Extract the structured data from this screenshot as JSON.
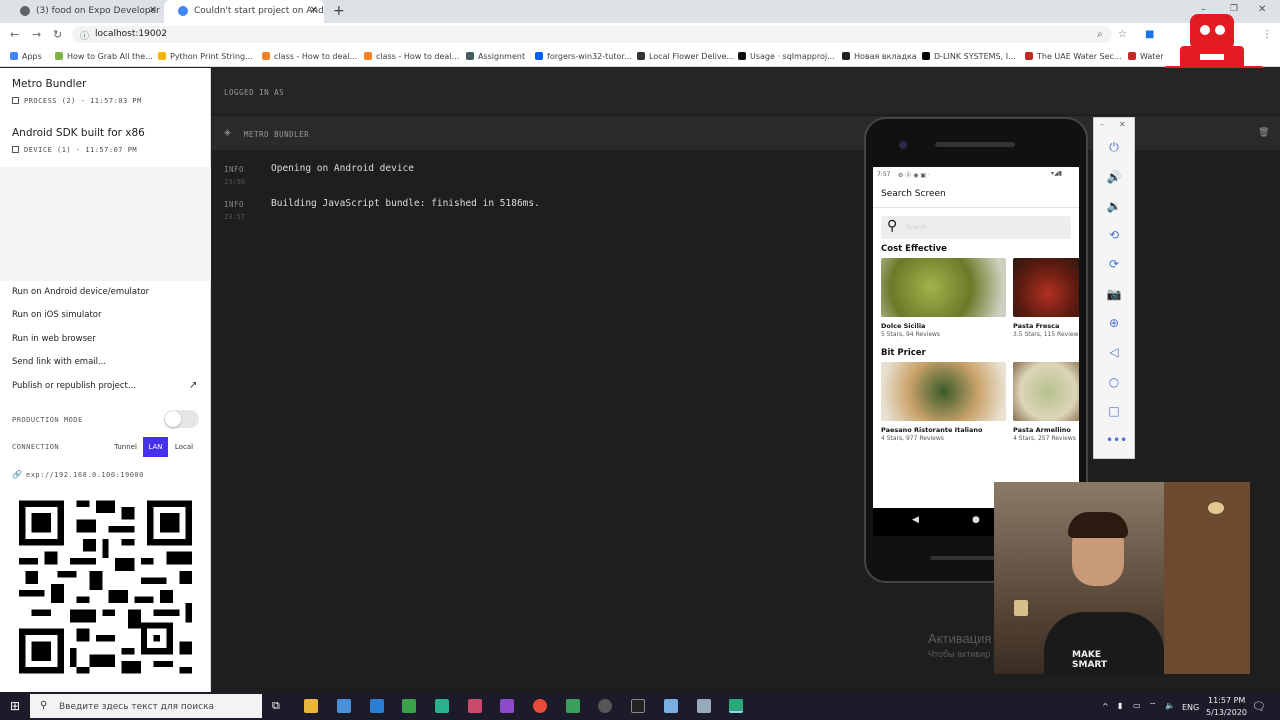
{
  "browser": {
    "tabs": [
      {
        "title": "(3) food on Expo Developer Tools"
      },
      {
        "title": "Couldn't start project on Android"
      }
    ],
    "new_tab": "+",
    "url": "localhost:19002",
    "bookmarks": [
      "Apps",
      "How to Grab All the...",
      "Python Print String...",
      "class - How to deal...",
      "class - How to deal...",
      "Assignment",
      "forgers-win32-tutor...",
      "Local Flower Delive...",
      "Usage · sqlmapproj...",
      "Новая вкладка",
      "D-LINK SYSTEMS, I...",
      "The UAE Water Sec...",
      "Water"
    ]
  },
  "sidebar": {
    "bundler_title": "Metro Bundler",
    "bundler_process": "PROCESS (2) - 11:57:03 PM",
    "device_title": "Android SDK built for x86",
    "device_info": "DEVICE (1) - 11:57:07 PM",
    "actions": [
      "Run on Android device/emulator",
      "Run on iOS simulator",
      "Run in web browser",
      "Send link with email...",
      "Publish or republish project..."
    ],
    "production_mode_label": "PRODUCTION MODE",
    "production_mode": false,
    "connection_label": "CONNECTION",
    "connection_options": [
      "Tunnel",
      "LAN",
      "Local"
    ],
    "connection_selected": "LAN",
    "exp_url": "exp://192.168.0.100:19000"
  },
  "main": {
    "logged_in": "LOGGED IN AS",
    "panel_title": "METRO BUNDLER",
    "logs": [
      {
        "level": "INFO",
        "time": "23:56",
        "message": "Opening on Android device"
      },
      {
        "level": "INFO",
        "time": "23:57",
        "message": "Building JavaScript bundle: finished in 5186ms."
      }
    ]
  },
  "phone": {
    "status_time": "7:57",
    "screen_title": "Search Screen",
    "search_placeholder": "Search",
    "sections": [
      {
        "title": "Cost Effective",
        "items": [
          {
            "name": "Dolce Sicilia",
            "info": "5 Stars, 94 Reviews"
          },
          {
            "name": "Pasta Fresca",
            "info": "3.5 Stars, 115 Review"
          }
        ]
      },
      {
        "title": "Bit Pricer",
        "items": [
          {
            "name": "Paesano Ristorante Italiano",
            "info": "4 Stars, 977 Reviews"
          },
          {
            "name": "Pasta Armellino",
            "info": "4 Stars, 257 Reviews"
          }
        ]
      }
    ]
  },
  "webcam": {
    "shirt_text": "MAKE SMART"
  },
  "watermark": {
    "line1": "Активация",
    "line2": "Чтобы активир"
  },
  "taskbar": {
    "search_placeholder": "Введите здесь текст для поиска",
    "lang": "ENG",
    "time": "11:57 PM",
    "date": "5/13/2020"
  }
}
